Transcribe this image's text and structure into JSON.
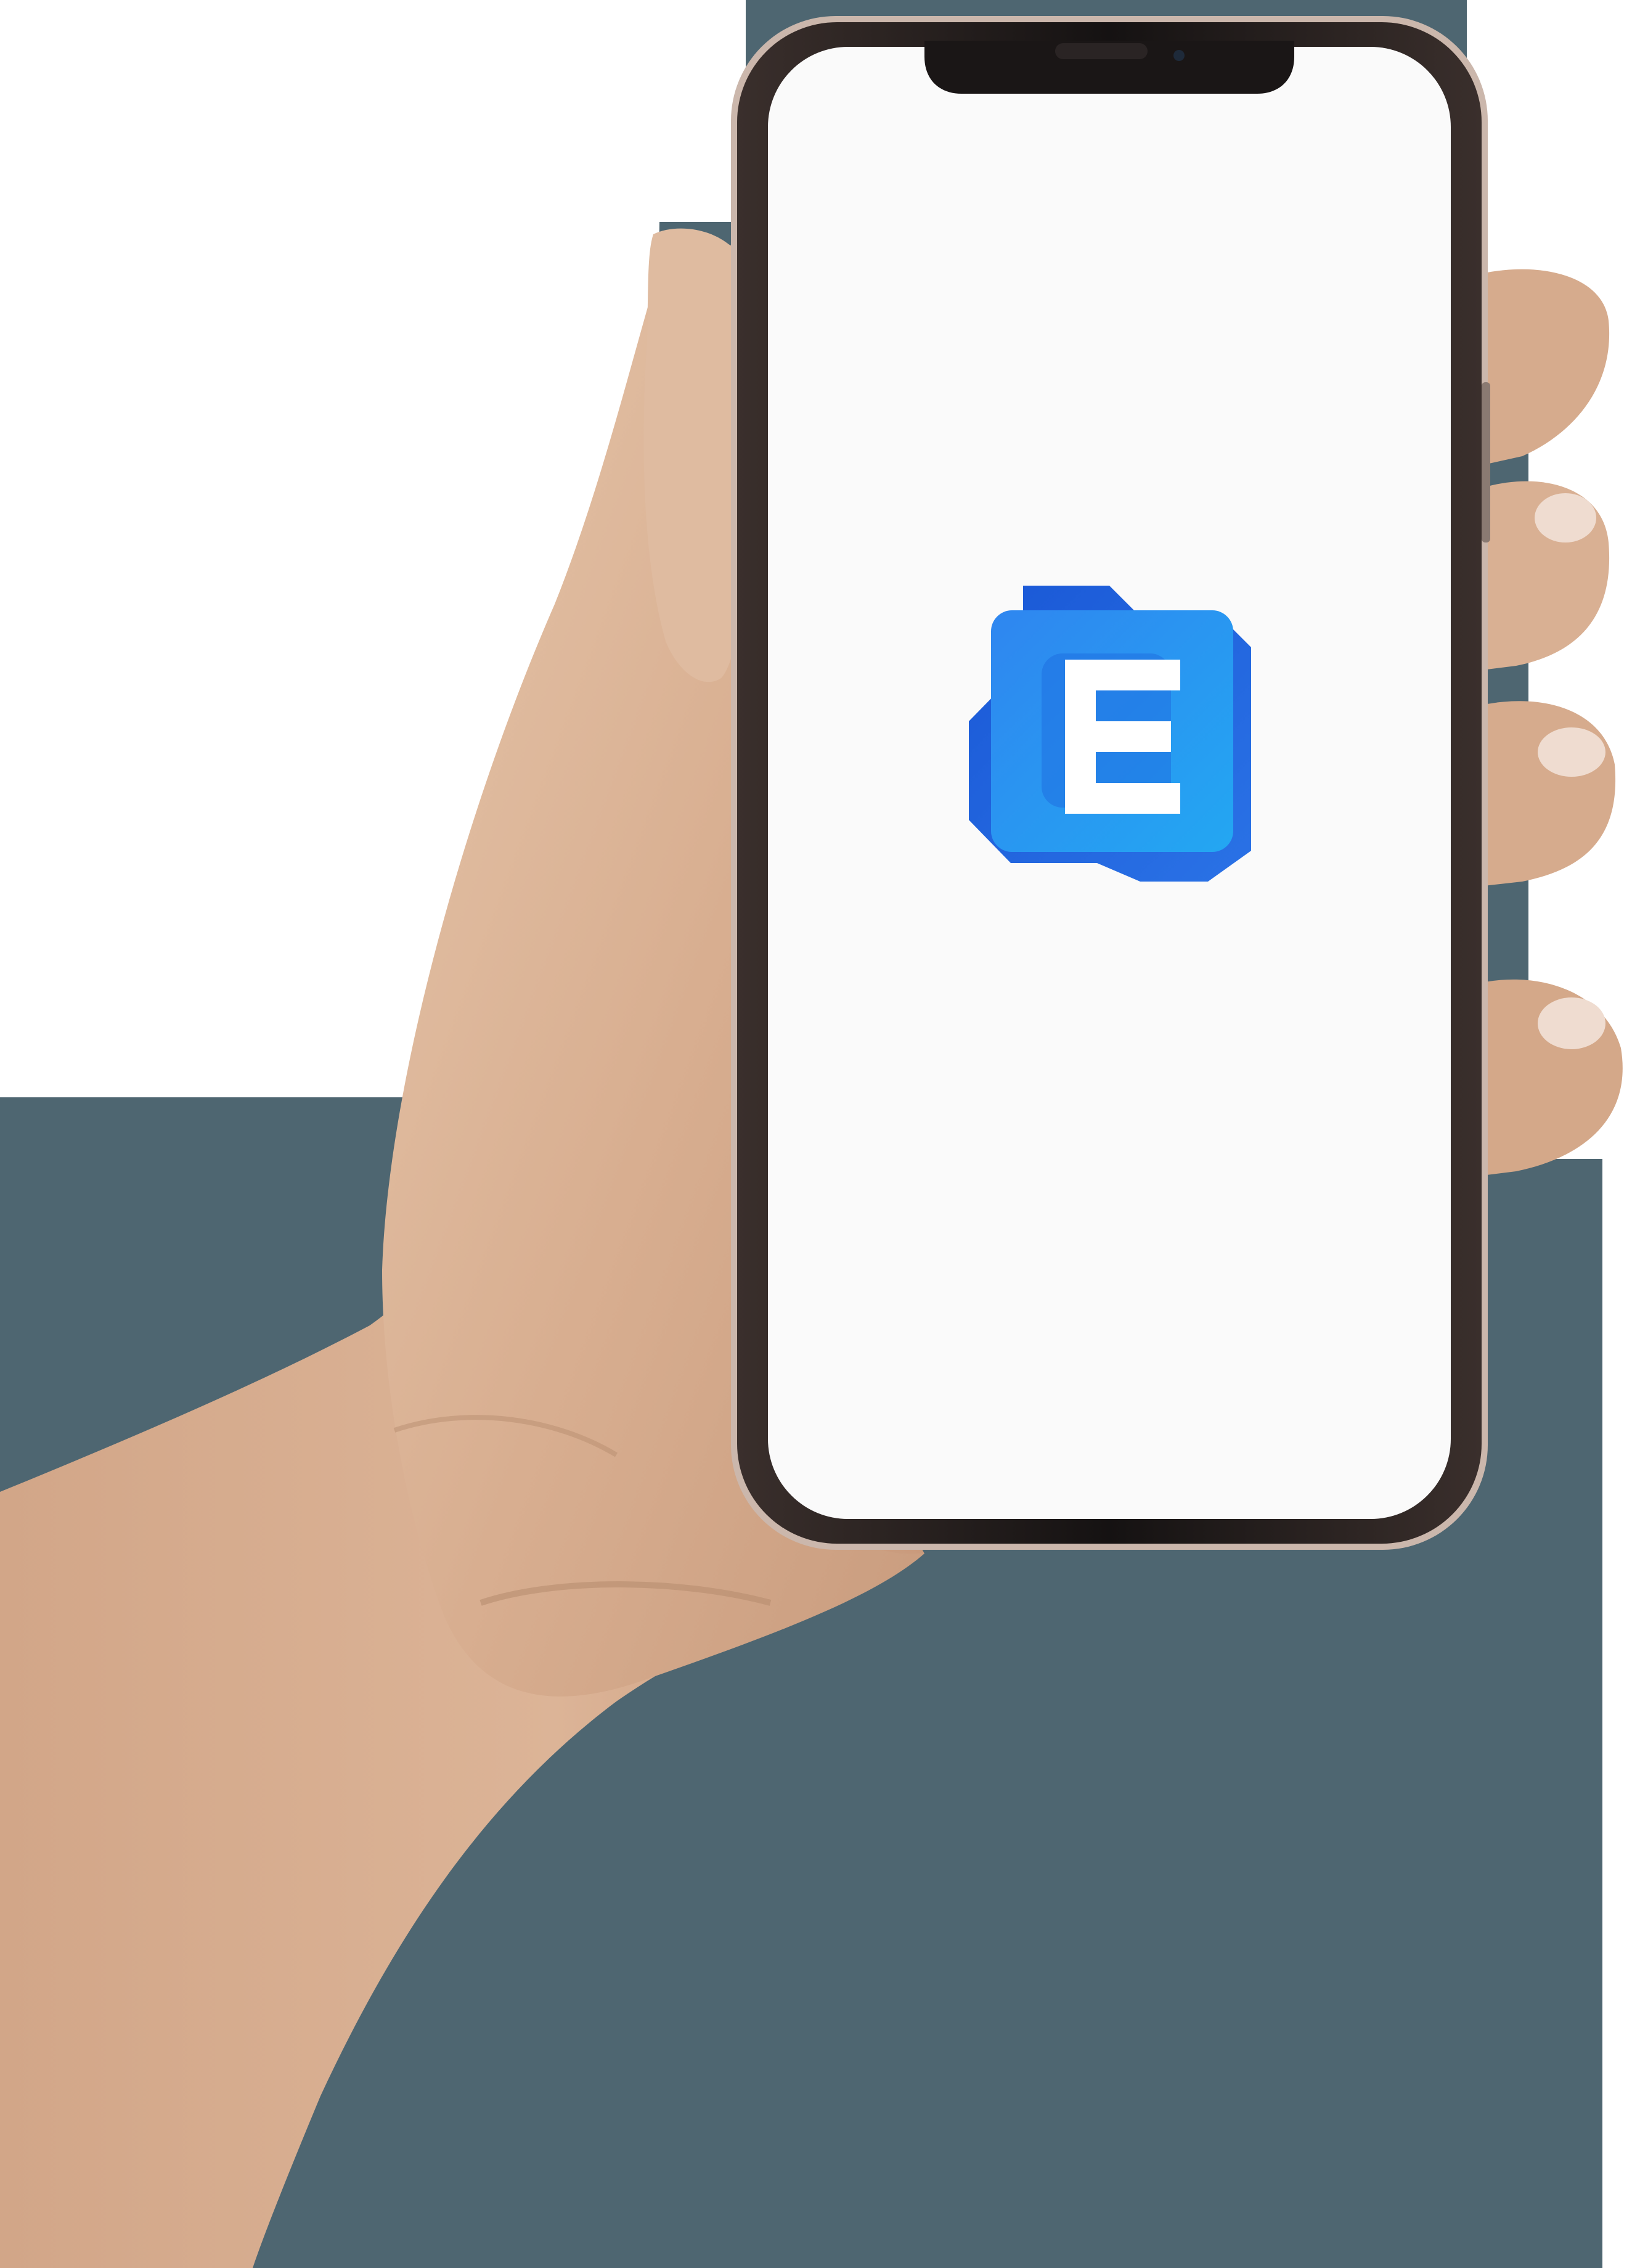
{
  "colors": {
    "backdrop": "#4e6671",
    "cutout_white": "#ffffff",
    "skin_base": "#d9b294",
    "skin_shadow": "#b98f72",
    "skin_highlight": "#e9ccb3",
    "phone_frame": "#1c1818",
    "phone_rim": "#cbb7ac",
    "screen": "#fafafa",
    "logo_dark": "#1d5fdc",
    "logo_mid": "#2b7ef0",
    "logo_light": "#27a3f2",
    "logo_letter": "#ffffff"
  },
  "photo": {
    "subject": "hand-holding-smartphone",
    "phone": {
      "screen_state": "splash-screen",
      "icons": [
        "app-logo-icon"
      ]
    }
  }
}
